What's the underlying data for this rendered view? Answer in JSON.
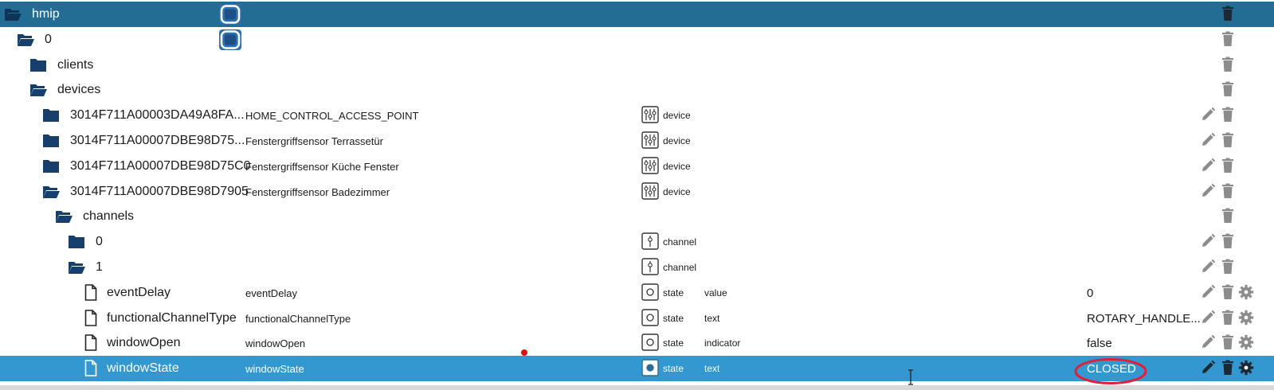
{
  "rows": [
    {
      "name": "hmip",
      "folder": "open",
      "indent": 0,
      "title": "",
      "type": "",
      "role": "",
      "value": "",
      "actions": [
        "delete"
      ],
      "selected": "dark",
      "appicon": true
    },
    {
      "name": "0",
      "folder": "open",
      "indent": 1,
      "title": "",
      "type": "",
      "role": "",
      "value": "",
      "actions": [
        "delete"
      ],
      "selected": "",
      "appicon": true
    },
    {
      "name": "clients",
      "folder": "closed",
      "indent": 2,
      "title": "",
      "type": "",
      "role": "",
      "value": "",
      "actions": [
        "delete"
      ],
      "selected": ""
    },
    {
      "name": "devices",
      "folder": "open",
      "indent": 2,
      "title": "",
      "type": "",
      "role": "",
      "value": "",
      "actions": [
        "delete"
      ],
      "selected": ""
    },
    {
      "name": "3014F711A00003DA49A8FA...",
      "folder": "closed",
      "indent": 3,
      "title": "HOME_CONTROL_ACCESS_POINT",
      "type": "device",
      "role": "",
      "value": "",
      "actions": [
        "edit",
        "delete"
      ],
      "selected": ""
    },
    {
      "name": "3014F711A00007DBE98D75...",
      "folder": "closed",
      "indent": 3,
      "title": "Fenstergriffsensor Terrassetür",
      "type": "device",
      "role": "",
      "value": "",
      "actions": [
        "edit",
        "delete"
      ],
      "selected": ""
    },
    {
      "name": "3014F711A00007DBE98D75C0",
      "folder": "closed",
      "indent": 3,
      "title": "Fenstergriffsensor Küche Fenster",
      "type": "device",
      "role": "",
      "value": "",
      "actions": [
        "edit",
        "delete"
      ],
      "selected": ""
    },
    {
      "name": "3014F711A00007DBE98D7905",
      "folder": "open",
      "indent": 3,
      "title": "Fenstergriffsensor Badezimmer",
      "type": "device",
      "role": "",
      "value": "",
      "actions": [
        "edit",
        "delete"
      ],
      "selected": ""
    },
    {
      "name": "channels",
      "folder": "open",
      "indent": 4,
      "title": "",
      "type": "",
      "role": "",
      "value": "",
      "actions": [
        "delete"
      ],
      "selected": ""
    },
    {
      "name": "0",
      "folder": "closed",
      "indent": 5,
      "title": "",
      "type": "channel",
      "role": "",
      "value": "",
      "actions": [
        "edit",
        "delete"
      ],
      "selected": ""
    },
    {
      "name": "1",
      "folder": "open",
      "indent": 5,
      "title": "",
      "type": "channel",
      "role": "",
      "value": "",
      "actions": [
        "edit",
        "delete"
      ],
      "selected": ""
    },
    {
      "name": "eventDelay",
      "folder": "file",
      "indent": 6,
      "title": "eventDelay",
      "type": "state",
      "role": "value",
      "value": "0",
      "actions": [
        "edit",
        "delete",
        "config"
      ],
      "selected": ""
    },
    {
      "name": "functionalChannelType",
      "folder": "file",
      "indent": 6,
      "title": "functionalChannelType",
      "type": "state",
      "role": "text",
      "value": "ROTARY_HANDLE...",
      "actions": [
        "edit",
        "delete",
        "config"
      ],
      "selected": ""
    },
    {
      "name": "windowOpen",
      "folder": "file",
      "indent": 6,
      "title": "windowOpen",
      "type": "state",
      "role": "indicator",
      "value": "false",
      "actions": [
        "edit",
        "delete",
        "config"
      ],
      "selected": ""
    },
    {
      "name": "windowState",
      "folder": "file",
      "indent": 6,
      "title": "windowState",
      "type": "state",
      "role": "text",
      "value": "CLOSED",
      "actions": [
        "edit",
        "delete",
        "config"
      ],
      "selected": "light"
    }
  ],
  "colors": {
    "selected_dark": "#236d94",
    "selected_light": "#3398cf",
    "folder": "#16406b",
    "action_gray": "#8c8c8c",
    "annotation_red": "#e0203a"
  }
}
